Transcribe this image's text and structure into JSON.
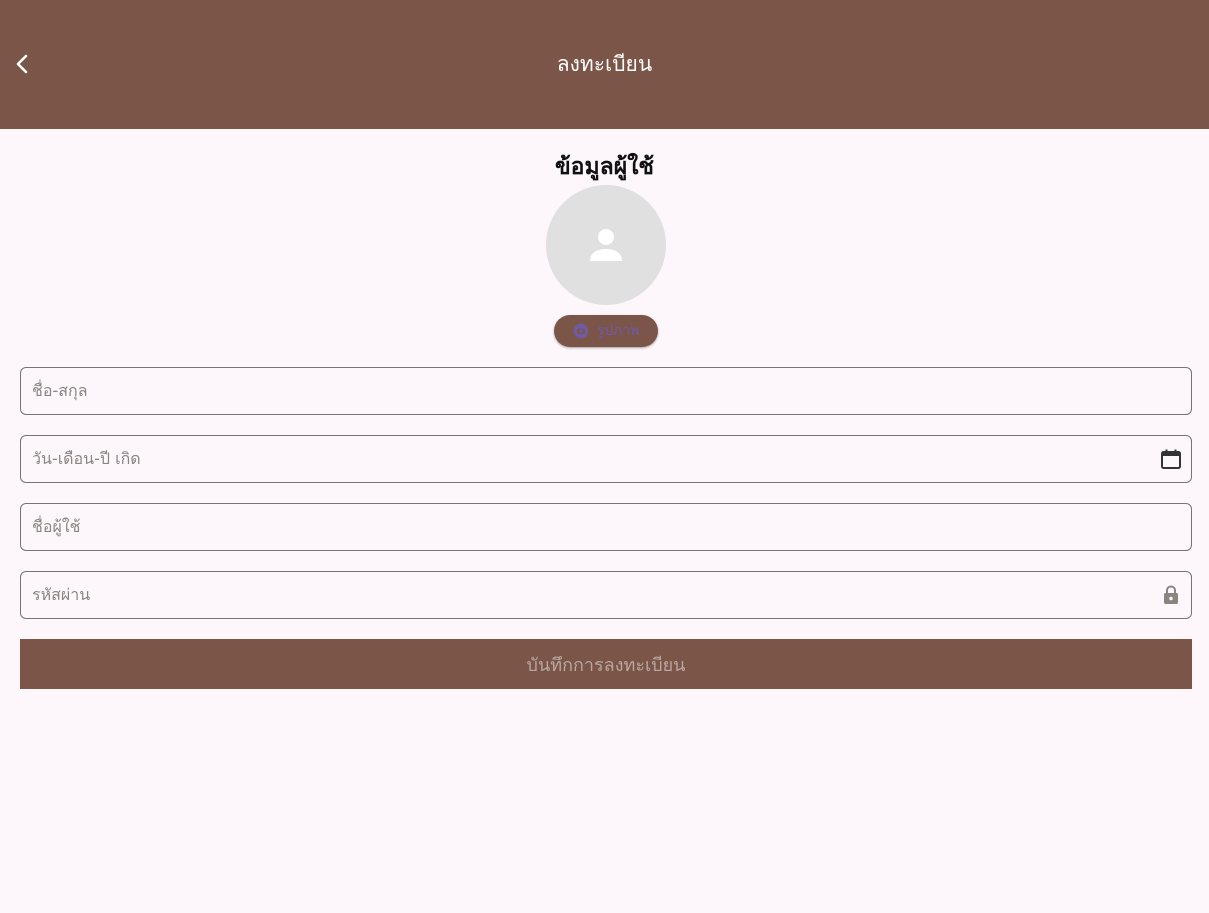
{
  "appbar": {
    "title": "ลงทะเบียน",
    "back_icon": "chevron-left-icon",
    "background_color": "#7a5548"
  },
  "profile": {
    "section_title": "ข้อมูลผู้ใช้",
    "avatar_icon": "person-icon",
    "photo_button": {
      "icon": "camera-icon",
      "label": "รูปภาพ"
    }
  },
  "form": {
    "fullname": {
      "placeholder": "ชื่อ-สกุล"
    },
    "birthdate": {
      "placeholder": "วัน-เดือน-ปี เกิด",
      "icon": "calendar-icon"
    },
    "username": {
      "placeholder": "ชื่อผู้ใช้"
    },
    "password": {
      "placeholder": "รหัสผ่าน",
      "icon": "lock-icon"
    },
    "submit_label": "บันทึกการลงทะเบียน"
  },
  "colors": {
    "primary": "#7a5548",
    "page_background": "#fdf7fc",
    "avatar_background": "#e0e0e0"
  }
}
